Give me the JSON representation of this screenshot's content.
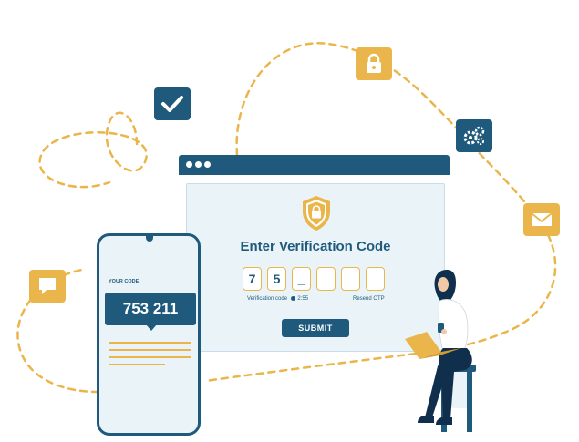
{
  "colors": {
    "navy": "#1f5a7d",
    "accent": "#eab54a",
    "panel": "#eaf4f8"
  },
  "icons": {
    "badges": [
      "checkmark-icon",
      "lock-icon",
      "gears-icon",
      "envelope-icon",
      "chat-icon"
    ],
    "shield": "shield-lock-icon"
  },
  "verification": {
    "title": "Enter Verification Code",
    "digits": [
      "7",
      "5",
      "_",
      "",
      "",
      ""
    ],
    "timer_label": "Verification code",
    "timer_value": "2:55",
    "resend_label": "Resend OTP",
    "submit_label": "SUBMIT"
  },
  "phone": {
    "label": "YOUR CODE",
    "code": "753 211"
  }
}
